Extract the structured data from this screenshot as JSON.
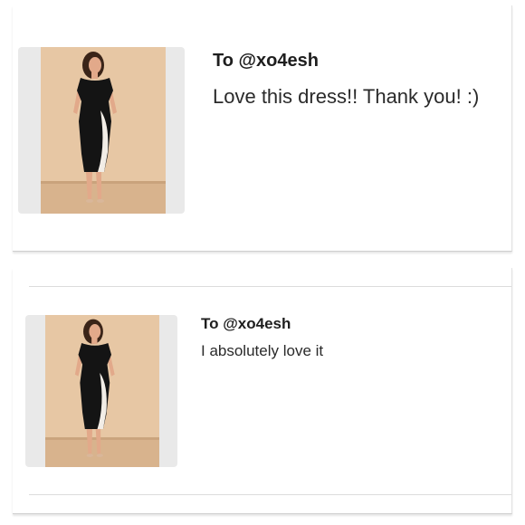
{
  "reviews": [
    {
      "recipient": "To @xo4esh",
      "message": "Love this dress!! Thank you! :)",
      "thumbnail": "dress-photo"
    },
    {
      "recipient": "To @xo4esh",
      "message": "I absolutely love it",
      "thumbnail": "dress-photo"
    }
  ],
  "colors": {
    "photo_background": "#e7c7a4",
    "dress_black": "#141414",
    "dress_panel": "#f2ede6",
    "floor": "#d8b38d"
  }
}
